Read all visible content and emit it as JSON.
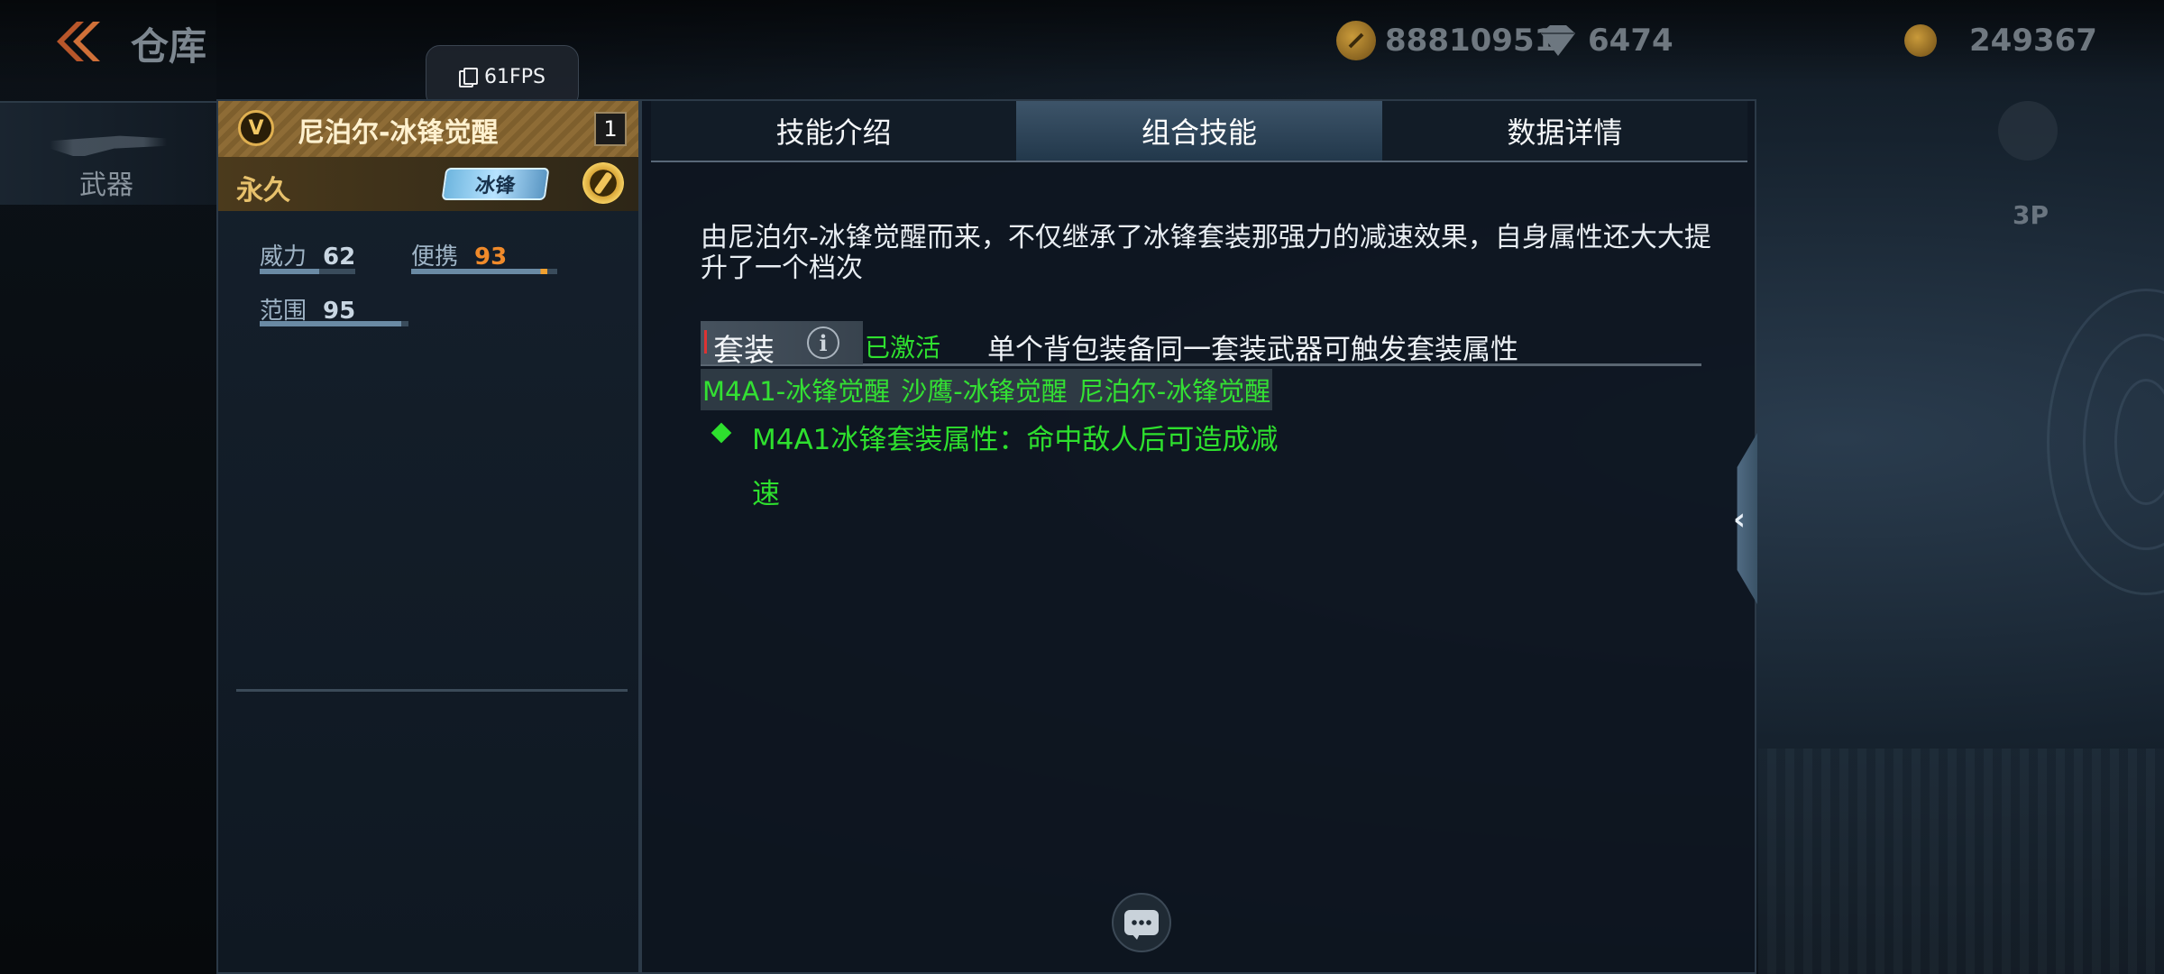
{
  "header": {
    "title": "仓库",
    "gold": "88810951",
    "diamond": "6474",
    "coin": "249367",
    "fps": "61FPS"
  },
  "sidebar": {
    "tab_label": "武器"
  },
  "right_controls": {
    "view_mode": "3P"
  },
  "weapon": {
    "rank": "V",
    "name": "尼泊尔-冰锋觉醒",
    "count": "1",
    "duration": "永久",
    "suit_tag": "冰锋",
    "stats": [
      {
        "label": "威力",
        "value": "62",
        "fill": 0.62,
        "highlight": false
      },
      {
        "label": "便携",
        "value": "93",
        "fill": 0.93,
        "highlight": true
      },
      {
        "label": "范围",
        "value": "95",
        "fill": 0.95,
        "highlight": false
      }
    ]
  },
  "tabs": [
    {
      "label": "技能介绍",
      "active": false
    },
    {
      "label": "组合技能",
      "active": true
    },
    {
      "label": "数据详情",
      "active": false
    }
  ],
  "skill": {
    "description": "由尼泊尔-冰锋觉醒而来，不仅继承了冰锋套装那强力的减速效果，自身属性还大大提升了一个档次",
    "suit_label": "套装",
    "info_icon": "i",
    "status": "已激活",
    "hint": "单个背包装备同一套装武器可触发套装属性",
    "members": [
      "M4A1-冰锋觉醒",
      "沙鹰-冰锋觉醒",
      "尼泊尔-冰锋觉醒"
    ],
    "effect": "M4A1冰锋套装属性：命中敌人后可造成减速"
  },
  "colors": {
    "active_green": "#2ee02e",
    "gold_accent": "#e7c16c",
    "highlight_orange": "#f08a2a"
  }
}
